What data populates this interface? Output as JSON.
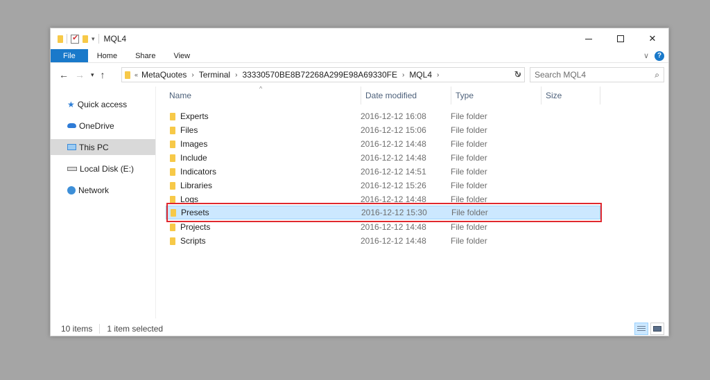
{
  "window": {
    "title": "MQL4"
  },
  "ribbon": {
    "tabs": [
      "File",
      "Home",
      "Share",
      "View"
    ]
  },
  "address": {
    "breadcrumbs": [
      "MetaQuotes",
      "Terminal",
      "33330570BE8B72268A299E98A69330FE",
      "MQL4"
    ]
  },
  "search": {
    "placeholder": "Search MQL4"
  },
  "sidebar": {
    "items": [
      {
        "label": "Quick access",
        "icon": "star-icon"
      },
      {
        "label": "OneDrive",
        "icon": "cloud-icon"
      },
      {
        "label": "This PC",
        "icon": "computer-icon",
        "selected": true
      },
      {
        "label": "Local Disk (E:)",
        "icon": "drive-icon"
      },
      {
        "label": "Network",
        "icon": "network-icon"
      }
    ]
  },
  "columns": {
    "name": "Name",
    "date": "Date modified",
    "type": "Type",
    "size": "Size"
  },
  "files": [
    {
      "name": "Experts",
      "date": "2016-12-12 16:08",
      "type": "File folder"
    },
    {
      "name": "Files",
      "date": "2016-12-12 15:06",
      "type": "File folder"
    },
    {
      "name": "Images",
      "date": "2016-12-12 14:48",
      "type": "File folder"
    },
    {
      "name": "Include",
      "date": "2016-12-12 14:48",
      "type": "File folder"
    },
    {
      "name": "Indicators",
      "date": "2016-12-12 14:51",
      "type": "File folder"
    },
    {
      "name": "Libraries",
      "date": "2016-12-12 15:26",
      "type": "File folder"
    },
    {
      "name": "Logs",
      "date": "2016-12-12 14:48",
      "type": "File folder"
    },
    {
      "name": "Presets",
      "date": "2016-12-12 15:30",
      "type": "File folder",
      "selected": true
    },
    {
      "name": "Projects",
      "date": "2016-12-12 14:48",
      "type": "File folder"
    },
    {
      "name": "Scripts",
      "date": "2016-12-12 14:48",
      "type": "File folder"
    }
  ],
  "status": {
    "count": "10 items",
    "selection": "1 item selected"
  },
  "colors": {
    "accent": "#1979ca",
    "selection": "#cce8ff",
    "highlight": "#e0282e",
    "folder": "#f7c948"
  }
}
